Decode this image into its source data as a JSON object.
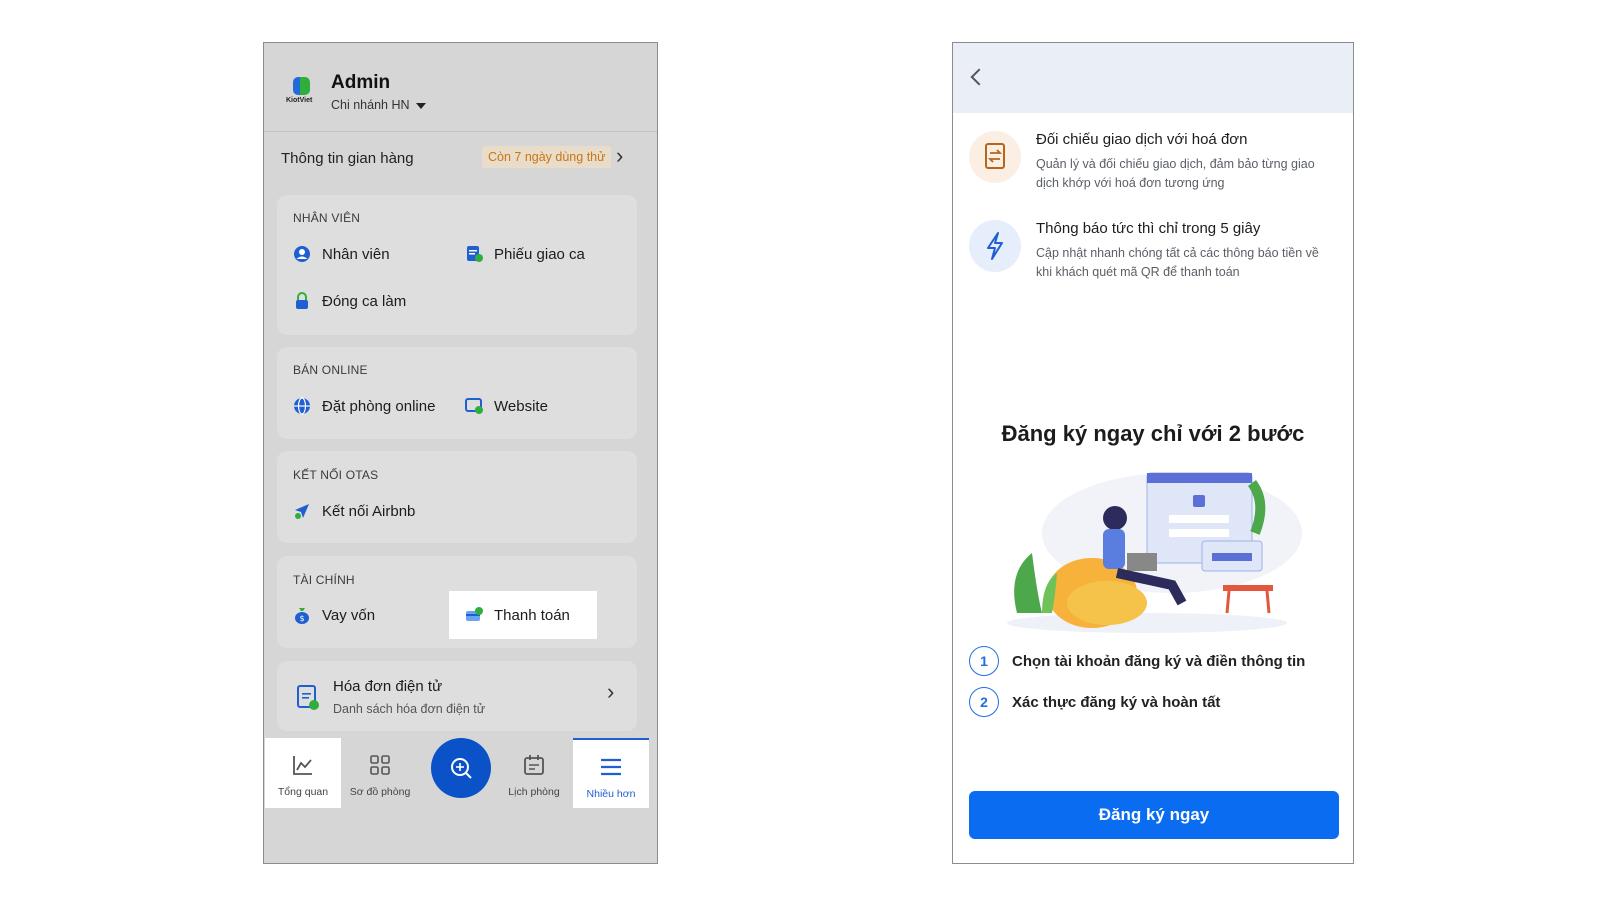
{
  "left": {
    "logo_text": "KiotViet",
    "user_name": "Admin",
    "branch": "Chi nhánh HN",
    "shop_info": "Thông tin gian hàng",
    "trial_badge": "Còn 7 ngày dùng thử",
    "sections": {
      "staff": {
        "title": "NHÂN VIÊN",
        "items": [
          "Nhân viên",
          "Phiếu giao ca",
          "Đóng ca làm"
        ]
      },
      "online": {
        "title": "BÁN ONLINE",
        "items": [
          "Đặt phòng online",
          "Website"
        ]
      },
      "otas": {
        "title": "KẾT NỐI OTAS",
        "items": [
          "Kết nối Airbnb"
        ]
      },
      "finance": {
        "title": "TÀI CHÍNH",
        "items": [
          "Vay vốn",
          "Thanh toán"
        ]
      }
    },
    "invoice": {
      "title": "Hóa đơn điện tử",
      "subtitle": "Danh sách hóa đơn điện tử"
    },
    "nav": [
      "Tổng quan",
      "Sơ đồ phòng",
      "Lịch phòng",
      "Nhiều hơn"
    ]
  },
  "right": {
    "features": [
      {
        "title": "Đối chiếu giao dịch với hoá đơn",
        "desc": "Quản lý và đối chiếu giao dịch, đảm bảo từng giao dịch khớp với hoá đơn tương ứng"
      },
      {
        "title": "Thông báo tức thì chỉ trong 5 giây",
        "desc": "Cập nhật nhanh chóng tất cả các thông báo tiền về khi khách quét mã QR để thanh toán"
      }
    ],
    "register_title": "Đăng ký ngay chỉ với 2 bước",
    "steps": [
      {
        "num": "1",
        "text": "Chọn tài khoản đăng ký và điền thông tin"
      },
      {
        "num": "2",
        "text": "Xác thực đăng ký và hoàn tất"
      }
    ],
    "cta": "Đăng ký ngay"
  },
  "colors": {
    "primary": "#0a6cf0",
    "fab": "#0b52c8",
    "trial_text": "#c9761a",
    "nav_active": "#1f5fd1"
  }
}
